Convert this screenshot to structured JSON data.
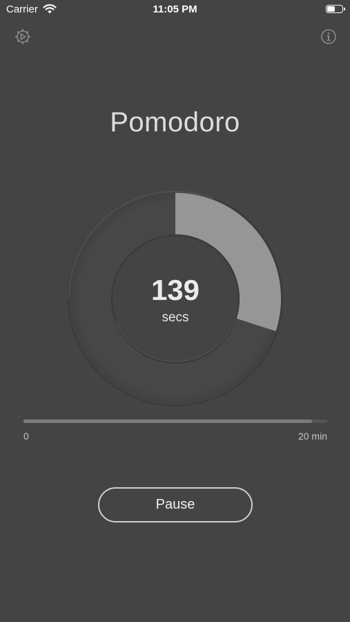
{
  "status_bar": {
    "carrier": "Carrier",
    "time": "11:05 PM",
    "battery_level": 0.55
  },
  "toolbar": {
    "settings_icon": "gear-icon",
    "info_icon": "info-icon"
  },
  "title": "Pomodoro",
  "timer": {
    "value": "139",
    "unit": "secs",
    "progress": 0.3
  },
  "duration_slider": {
    "min_label": "0",
    "max_label": "20 min",
    "value_fraction": 0.95
  },
  "pause_button": {
    "label": "Pause"
  },
  "colors": {
    "background": "#444444",
    "progress_fill": "#969696",
    "ring_track": "#464646",
    "text": "#e6e6e6"
  }
}
